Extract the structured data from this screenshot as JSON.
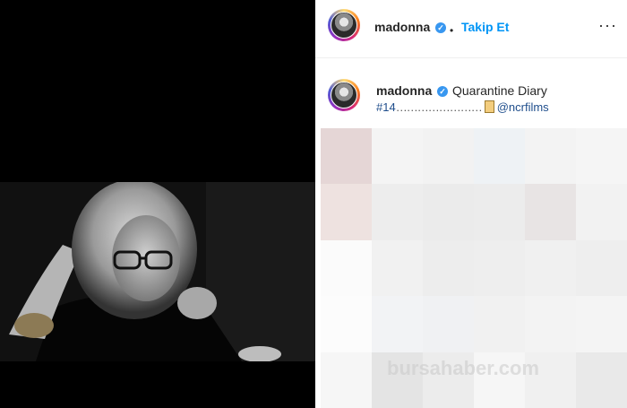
{
  "header": {
    "username": "madonna",
    "verified_icon": "verified-check-icon",
    "separator": "•",
    "follow_label": "Takip Et",
    "more_icon": "more-options-icon",
    "more_glyph": "···"
  },
  "post": {
    "username": "madonna",
    "caption": "Quarantine Diary",
    "hashtag": "#14",
    "dots": "……………………",
    "mention": "@ncrfilms",
    "scroll_icon": "scroll-emoji-icon"
  },
  "watermark": "bursahaber.com",
  "colors": {
    "accent": "#0095f6",
    "verified": "#3897f0",
    "link": "#1f4e8c"
  }
}
